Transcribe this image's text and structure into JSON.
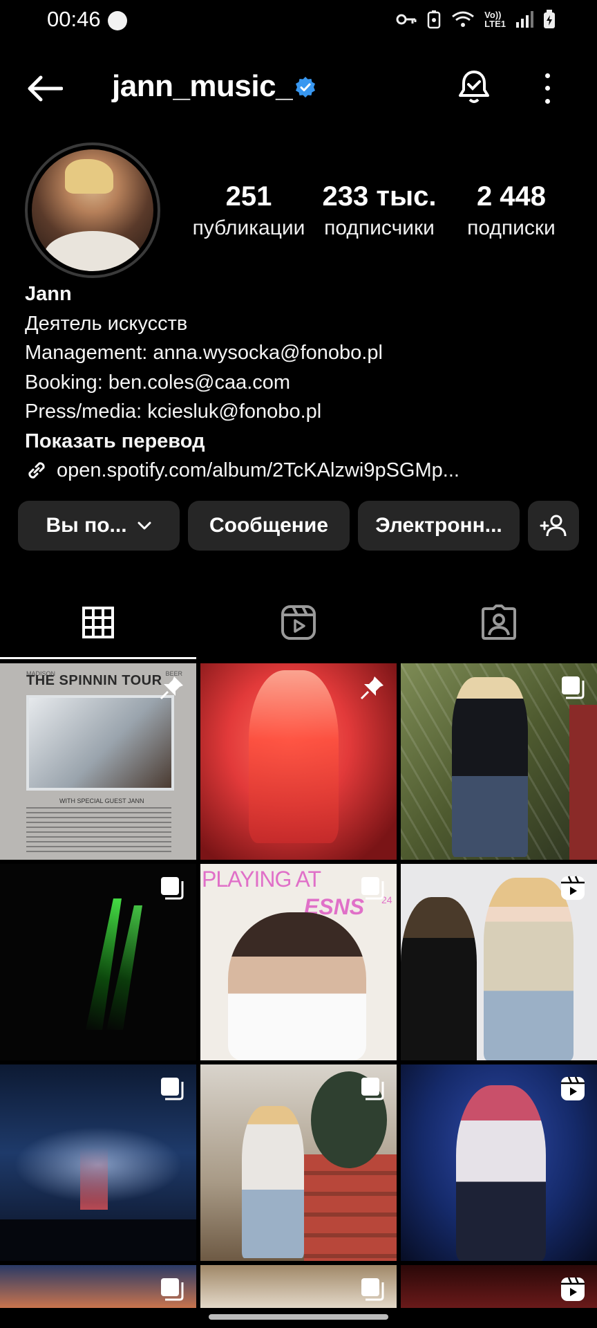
{
  "status_bar": {
    "time": "00:46",
    "network": "Vo))\nLTE1"
  },
  "header": {
    "username": "jann_music_"
  },
  "stats": [
    {
      "value": "251",
      "label": "публикации"
    },
    {
      "value": "233 тыс.",
      "label": "подписчики"
    },
    {
      "value": "2 448",
      "label": "подписки"
    }
  ],
  "bio": {
    "name": "Jann",
    "category": "Деятель искусств",
    "lines": [
      "Management: anna.wysocka@fonobo.pl",
      "Booking: ben.coles@caa.com",
      "Press/media: kciesluk@fonobo.pl"
    ],
    "translate": "Показать перевод",
    "link": "open.spotify.com/album/2TcKAlzwi9pSGMp..."
  },
  "buttons": {
    "following": "Вы по...",
    "message": "Сообщение",
    "email": "Электронн..."
  },
  "posts": [
    {
      "type": "pinned",
      "caption_top": "THE SPINNIN TOUR",
      "caption_small_left": "MADISON",
      "caption_small_right": "BEER",
      "guest": "WITH SPECIAL GUEST   JANN"
    },
    {
      "type": "pinned"
    },
    {
      "type": "carousel"
    },
    {
      "type": "carousel"
    },
    {
      "type": "carousel",
      "caption_top": "PLAYING AT",
      "caption_brand": "ESNS",
      "caption_year": "24"
    },
    {
      "type": "reel"
    },
    {
      "type": "carousel"
    },
    {
      "type": "carousel"
    },
    {
      "type": "reel"
    },
    {
      "type": "carousel"
    },
    {
      "type": "carousel"
    },
    {
      "type": "reel"
    }
  ],
  "colors": {
    "accent_verified": "#3897f0",
    "button_bg": "#262626",
    "background": "#000000"
  }
}
